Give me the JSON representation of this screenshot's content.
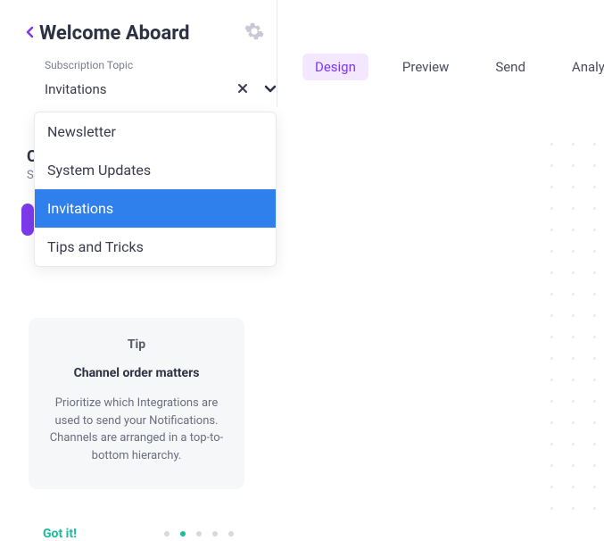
{
  "header": {
    "title": "Welcome Aboard",
    "subscription_label": "Subscription Topic",
    "selected_value": "Invitations"
  },
  "tabs": [
    {
      "label": "Design",
      "active": true
    },
    {
      "label": "Preview",
      "active": false
    },
    {
      "label": "Send",
      "active": false
    },
    {
      "label": "Analytics",
      "active": false
    }
  ],
  "dropdown_options": [
    {
      "label": "Newsletter",
      "selected": false
    },
    {
      "label": "System Updates",
      "selected": false
    },
    {
      "label": "Invitations",
      "selected": true
    },
    {
      "label": "Tips and Tricks",
      "selected": false
    }
  ],
  "partial_behind": {
    "c": "C",
    "s": "S"
  },
  "tip": {
    "label": "Tip",
    "title": "Channel order matters",
    "body": "Prioritize which Integrations are used to send your Notifications. Channels are arranged in a top-to-bottom hierarchy.",
    "got_it": "Got it!",
    "active_dot": 1,
    "dot_count": 5
  }
}
